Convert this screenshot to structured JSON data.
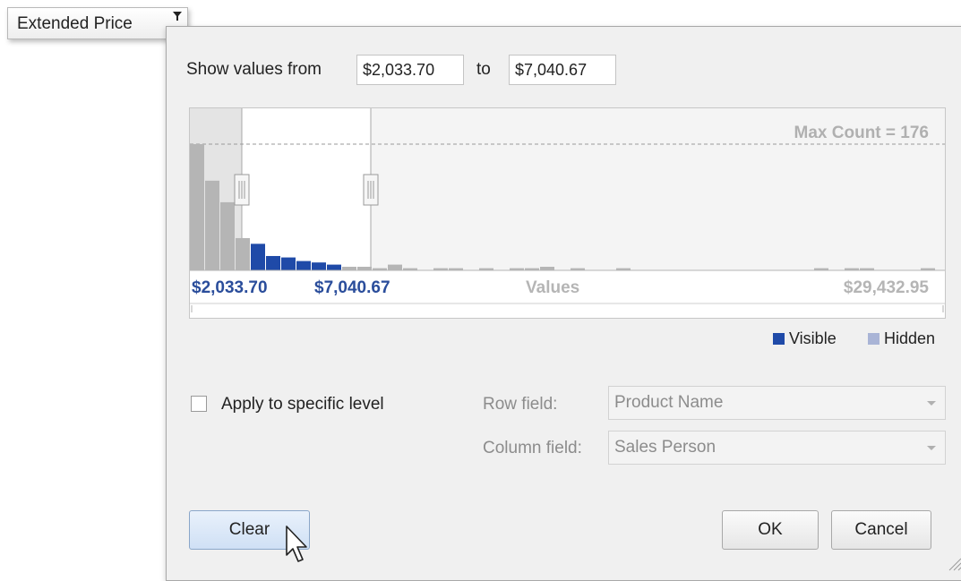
{
  "field_header": {
    "label": "Extended Price",
    "filter_icon": "filter-icon"
  },
  "range": {
    "from_label": "Show values from",
    "from_value": "$2,033.70",
    "to_label": "to",
    "to_value": "$7,040.67"
  },
  "histogram": {
    "max_count_label": "Max Count = 176",
    "min_value_label": "$2,033.70",
    "selected_max_label": "$7,040.67",
    "axis_label": "Values",
    "max_value_label": "$29,432.95",
    "max_count": 176,
    "bars": [
      {
        "count": 176,
        "visible": false
      },
      {
        "count": 125,
        "visible": false
      },
      {
        "count": 95,
        "visible": false
      },
      {
        "count": 45,
        "visible": false
      },
      {
        "count": 37,
        "visible": true
      },
      {
        "count": 20,
        "visible": true
      },
      {
        "count": 18,
        "visible": true
      },
      {
        "count": 13,
        "visible": true
      },
      {
        "count": 11,
        "visible": true
      },
      {
        "count": 8,
        "visible": true
      },
      {
        "count": 5,
        "visible": false
      },
      {
        "count": 5,
        "visible": false
      },
      {
        "count": 3,
        "visible": false
      },
      {
        "count": 8,
        "visible": false
      },
      {
        "count": 3,
        "visible": false
      },
      {
        "count": 0,
        "visible": false
      },
      {
        "count": 3,
        "visible": false
      },
      {
        "count": 3,
        "visible": false
      },
      {
        "count": 0,
        "visible": false
      },
      {
        "count": 3,
        "visible": false
      },
      {
        "count": 0,
        "visible": false
      },
      {
        "count": 3,
        "visible": false
      },
      {
        "count": 3,
        "visible": false
      },
      {
        "count": 5,
        "visible": false
      },
      {
        "count": 0,
        "visible": false
      },
      {
        "count": 3,
        "visible": false
      },
      {
        "count": 0,
        "visible": false
      },
      {
        "count": 0,
        "visible": false
      },
      {
        "count": 3,
        "visible": false
      },
      {
        "count": 0,
        "visible": false
      },
      {
        "count": 0,
        "visible": false
      },
      {
        "count": 0,
        "visible": false
      },
      {
        "count": 0,
        "visible": false
      },
      {
        "count": 0,
        "visible": false
      },
      {
        "count": 0,
        "visible": false
      },
      {
        "count": 0,
        "visible": false
      },
      {
        "count": 0,
        "visible": false
      },
      {
        "count": 0,
        "visible": false
      },
      {
        "count": 0,
        "visible": false
      },
      {
        "count": 0,
        "visible": false
      },
      {
        "count": 0,
        "visible": false
      },
      {
        "count": 3,
        "visible": false
      },
      {
        "count": 0,
        "visible": false
      },
      {
        "count": 3,
        "visible": false
      },
      {
        "count": 3,
        "visible": false
      },
      {
        "count": 0,
        "visible": false
      },
      {
        "count": 0,
        "visible": false
      },
      {
        "count": 0,
        "visible": false
      },
      {
        "count": 3,
        "visible": false
      }
    ],
    "colors": {
      "visible": "#1f4aa8",
      "hidden": "#b5b5b5",
      "max_text": "#b0b0b0",
      "value_text": "#2a4d9b"
    }
  },
  "legend": {
    "visible_label": "Visible",
    "hidden_label": "Hidden",
    "visible_color": "#1f4aa8",
    "hidden_color": "#a9b4d6"
  },
  "level": {
    "apply_label": "Apply to specific level",
    "apply_checked": false,
    "row_field_label": "Row field:",
    "row_field_value": "Product Name",
    "column_field_label": "Column field:",
    "column_field_value": "Sales Person"
  },
  "buttons": {
    "clear": "Clear",
    "ok": "OK",
    "cancel": "Cancel"
  }
}
